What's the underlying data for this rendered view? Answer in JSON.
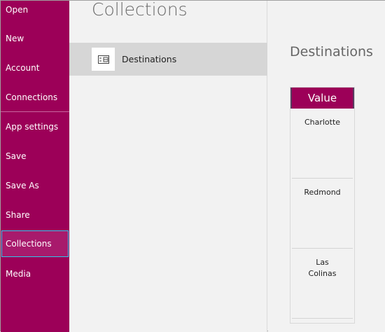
{
  "sidebar": {
    "items": [
      {
        "label": "Open"
      },
      {
        "label": "New"
      },
      {
        "label": "Account"
      },
      {
        "label": "Connections"
      },
      {
        "label": "App settings"
      },
      {
        "label": "Save"
      },
      {
        "label": "Save As"
      },
      {
        "label": "Share"
      },
      {
        "label": "Collections",
        "selected": true
      },
      {
        "label": "Media"
      }
    ]
  },
  "main": {
    "title": "Collections",
    "collections": [
      {
        "label": "Destinations",
        "icon": "table-icon"
      }
    ]
  },
  "preview": {
    "title": "Destinations",
    "header": "Value",
    "rows": [
      "Charlotte",
      "Redmond",
      "Las\nColinas"
    ]
  },
  "colors": {
    "accent": "#9c0058",
    "selection_border": "#2ec8e8"
  }
}
